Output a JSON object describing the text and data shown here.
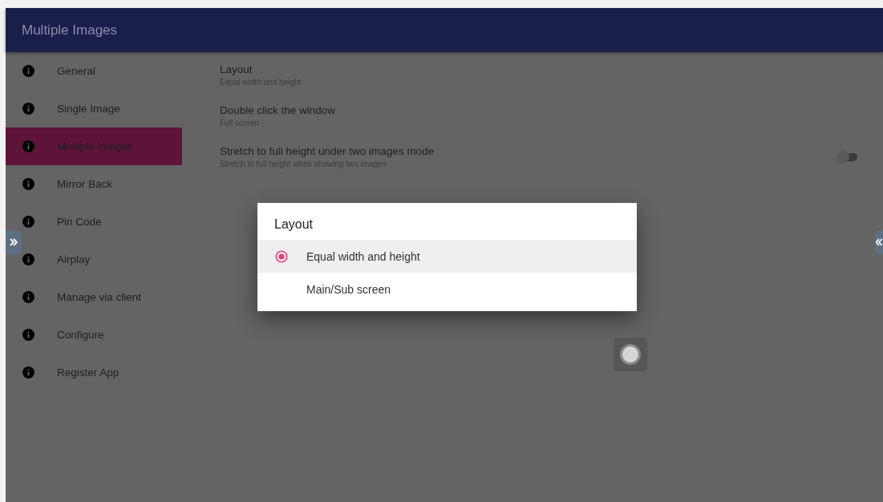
{
  "app_bar": {
    "title": "Multiple Images"
  },
  "sidebar": {
    "items": [
      {
        "label": "General",
        "selected": false
      },
      {
        "label": "Single Image",
        "selected": false
      },
      {
        "label": "Multiple Images",
        "selected": true
      },
      {
        "label": "Mirror Back",
        "selected": false
      },
      {
        "label": "Pin Code",
        "selected": false
      },
      {
        "label": "Airplay",
        "selected": false
      },
      {
        "label": "Manage via client",
        "selected": false
      },
      {
        "label": "Configure",
        "selected": false
      },
      {
        "label": "Register App",
        "selected": false
      }
    ]
  },
  "settings": [
    {
      "kind": "text",
      "title": "Layout",
      "summary": "Equal width and height"
    },
    {
      "kind": "text",
      "title": "Double click the window",
      "summary": "Full screen"
    },
    {
      "kind": "switch",
      "title": "Stretch to full height under two images mode",
      "summary": "Stretch to full height when showing two images",
      "on": false
    }
  ],
  "dialog": {
    "title": "Layout",
    "options": [
      {
        "label": "Equal width and height",
        "selected": true
      },
      {
        "label": "Main/Sub screen",
        "selected": false
      }
    ]
  }
}
